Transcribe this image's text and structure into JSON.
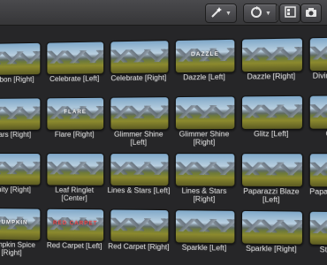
{
  "toolbar": {
    "wand_icon": "magic-wand-icon",
    "retime_icon": "retime-icon",
    "browser_icon": "film-strip-icon",
    "camera_icon": "camera-icon"
  },
  "grid": {
    "items": [
      {
        "label": "Ribbon [Right]",
        "overlay": ""
      },
      {
        "label": "Celebrate [Left]",
        "overlay": ""
      },
      {
        "label": "Celebrate [Right]",
        "overlay": ""
      },
      {
        "label": "Dazzle [Left]",
        "overlay": "DAZZLE"
      },
      {
        "label": "Dazzle [Right]",
        "overlay": ""
      },
      {
        "label": "Divine Co [Left]",
        "overlay": ""
      },
      {
        "label": "Stars [Right]",
        "overlay": ""
      },
      {
        "label": "Flare [Right]",
        "overlay": "FLARE"
      },
      {
        "label": "Glimmer Shine [Left]",
        "overlay": ""
      },
      {
        "label": "Glimmer Shine [Right]",
        "overlay": ""
      },
      {
        "label": "Glitz [Left]",
        "overlay": ""
      },
      {
        "label": "Glitz [Ri",
        "overlay": ""
      },
      {
        "label": "Unity [Right]",
        "overlay": ""
      },
      {
        "label": "Leaf Ringlet [Center]",
        "overlay": ""
      },
      {
        "label": "Lines & Stars [Left]",
        "overlay": ""
      },
      {
        "label": "Lines & Stars [Right]",
        "overlay": ""
      },
      {
        "label": "Paparazzi Blaze [Left]",
        "overlay": ""
      },
      {
        "label": "Paparazzi [Right]",
        "overlay": ""
      },
      {
        "label": "Pumpkin Spice [Right]",
        "overlay": "PUMPKIN"
      },
      {
        "label": "Red Carpet [Left]",
        "overlay": "RED CARPET",
        "red": true
      },
      {
        "label": "Red Carpet [Right]",
        "overlay": "",
        "red": true
      },
      {
        "label": "Sparkle [Left]",
        "overlay": ""
      },
      {
        "label": "Sparkle [Right]",
        "overlay": ""
      },
      {
        "label": "Stage Light",
        "overlay": ""
      }
    ]
  }
}
